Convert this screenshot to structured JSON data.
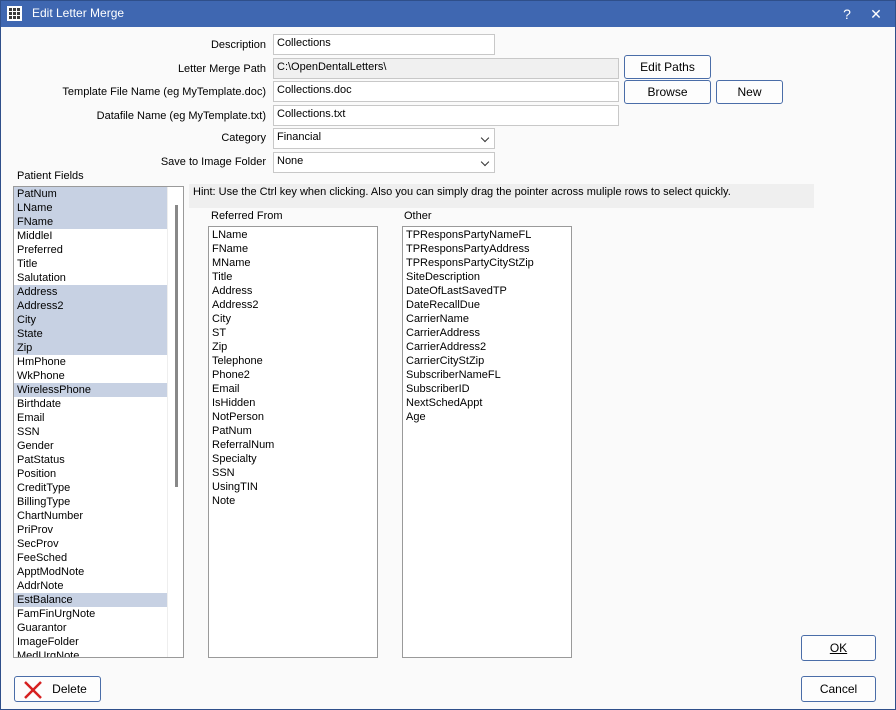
{
  "window": {
    "title": "Edit Letter Merge",
    "help_glyph": "?",
    "close_glyph": "✕"
  },
  "form": {
    "description_label": "Description",
    "description_value": "Collections",
    "path_label": "Letter Merge Path",
    "path_value": "C:\\OpenDentalLetters\\",
    "template_label": "Template File Name (eg MyTemplate.doc)",
    "template_value": "Collections.doc",
    "datafile_label": "Datafile Name (eg MyTemplate.txt)",
    "datafile_value": "Collections.txt",
    "category_label": "Category",
    "category_value": "Financial",
    "image_folder_label": "Save to Image Folder",
    "image_folder_value": "None"
  },
  "buttons": {
    "edit_paths": "Edit Paths",
    "browse": "Browse",
    "new": "New",
    "ok": "OK",
    "cancel": "Cancel",
    "delete": "Delete"
  },
  "hint": "Hint: Use the Ctrl key when clicking.  Also you can simply drag the pointer across muliple rows to select quickly.",
  "patient_fields": {
    "label": "Patient Fields",
    "items": [
      {
        "text": "PatNum",
        "selected": true
      },
      {
        "text": "LName",
        "selected": true
      },
      {
        "text": "FName",
        "selected": true
      },
      {
        "text": "MiddleI",
        "selected": false
      },
      {
        "text": "Preferred",
        "selected": false
      },
      {
        "text": "Title",
        "selected": false
      },
      {
        "text": "Salutation",
        "selected": false
      },
      {
        "text": "Address",
        "selected": true
      },
      {
        "text": "Address2",
        "selected": true
      },
      {
        "text": "City",
        "selected": true
      },
      {
        "text": "State",
        "selected": true
      },
      {
        "text": "Zip",
        "selected": true
      },
      {
        "text": "HmPhone",
        "selected": false
      },
      {
        "text": "WkPhone",
        "selected": false
      },
      {
        "text": "WirelessPhone",
        "selected": true
      },
      {
        "text": "Birthdate",
        "selected": false
      },
      {
        "text": "Email",
        "selected": false
      },
      {
        "text": "SSN",
        "selected": false
      },
      {
        "text": "Gender",
        "selected": false
      },
      {
        "text": "PatStatus",
        "selected": false
      },
      {
        "text": "Position",
        "selected": false
      },
      {
        "text": "CreditType",
        "selected": false
      },
      {
        "text": "BillingType",
        "selected": false
      },
      {
        "text": "ChartNumber",
        "selected": false
      },
      {
        "text": "PriProv",
        "selected": false
      },
      {
        "text": "SecProv",
        "selected": false
      },
      {
        "text": "FeeSched",
        "selected": false
      },
      {
        "text": "ApptModNote",
        "selected": false
      },
      {
        "text": "AddrNote",
        "selected": false
      },
      {
        "text": "EstBalance",
        "selected": true
      },
      {
        "text": "FamFinUrgNote",
        "selected": false
      },
      {
        "text": "Guarantor",
        "selected": false
      },
      {
        "text": "ImageFolder",
        "selected": false
      },
      {
        "text": "MedUrgNote",
        "selected": false
      }
    ]
  },
  "referred_from": {
    "label": "Referred From",
    "items": [
      "LName",
      "FName",
      "MName",
      "Title",
      "Address",
      "Address2",
      "City",
      "ST",
      "Zip",
      "Telephone",
      "Phone2",
      "Email",
      "IsHidden",
      "NotPerson",
      "PatNum",
      "ReferralNum",
      "Specialty",
      "SSN",
      "UsingTIN",
      "Note"
    ]
  },
  "other": {
    "label": "Other",
    "items": [
      "TPResponsPartyNameFL",
      "TPResponsPartyAddress",
      "TPResponsPartyCityStZip",
      "SiteDescription",
      "DateOfLastSavedTP",
      "DateRecallDue",
      "CarrierName",
      "CarrierAddress",
      "CarrierAddress2",
      "CarrierCityStZip",
      "SubscriberNameFL",
      "SubscriberID",
      "NextSchedAppt",
      "Age"
    ]
  },
  "colors": {
    "titlebar": "#3f67b1",
    "selection": "#c7d1e3",
    "button_border": "#4a6da8"
  }
}
